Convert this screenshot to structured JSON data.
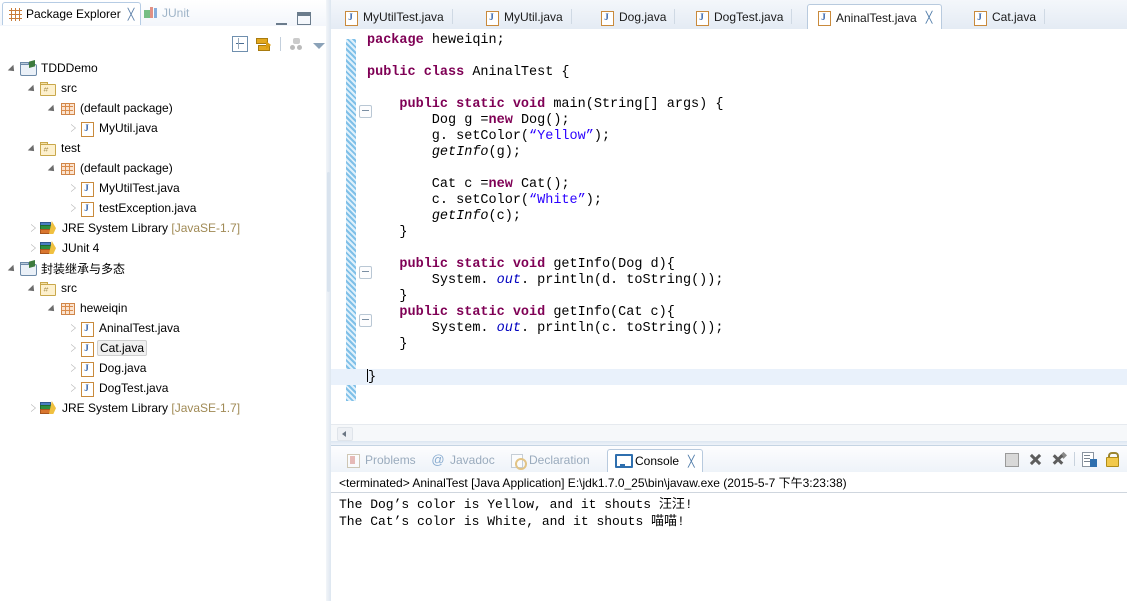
{
  "package_explorer": {
    "tabs": [
      {
        "label": "Package Explorer",
        "icon": "package-explorer-icon",
        "active": true,
        "close": "╳"
      },
      {
        "label": "JUnit",
        "icon": "junit-icon",
        "active": false,
        "close": "╳"
      }
    ],
    "toolbar": [
      {
        "name": "collapse-all-icon",
        "title": "Collapse All"
      },
      {
        "name": "link-with-editor-icon",
        "title": "Link with Editor"
      },
      {
        "name": "view-menu-icon",
        "title": "View Menu"
      },
      {
        "name": "view-chevron-down-icon",
        "title": "Menu"
      }
    ],
    "window_buttons": [
      {
        "name": "minimize-button",
        "glyph": "–"
      },
      {
        "name": "maximize-button",
        "glyph": "□"
      }
    ],
    "tree": [
      {
        "label": "TDDDemo",
        "icon": "java-project-icon",
        "indent": 0,
        "state": "expanded",
        "selected": false
      },
      {
        "label": "src",
        "icon": "source-folder-icon",
        "indent": 1,
        "state": "expanded",
        "selected": false
      },
      {
        "label": "(default package)",
        "icon": "package-icon",
        "indent": 2,
        "state": "expanded",
        "selected": false
      },
      {
        "label": "MyUtil.java",
        "icon": "java-file-icon",
        "indent": 3,
        "state": "collapsed",
        "selected": false
      },
      {
        "label": "test",
        "icon": "source-folder-icon",
        "indent": 1,
        "state": "expanded",
        "selected": false
      },
      {
        "label": "(default package)",
        "icon": "package-icon",
        "indent": 2,
        "state": "expanded",
        "selected": false
      },
      {
        "label": "MyUtilTest.java",
        "icon": "java-file-icon",
        "indent": 3,
        "state": "collapsed",
        "selected": false
      },
      {
        "label": "testException.java",
        "icon": "java-file-icon",
        "indent": 3,
        "state": "collapsed",
        "selected": false
      },
      {
        "label": "JRE System Library",
        "suffix": "[JavaSE-1.7]",
        "icon": "jre-library-icon",
        "indent": 1,
        "state": "collapsed",
        "selected": false
      },
      {
        "label": "JUnit 4",
        "icon": "jre-library-icon",
        "indent": 1,
        "state": "collapsed",
        "selected": false
      },
      {
        "label": "封装继承与多态",
        "icon": "java-project-icon",
        "indent": 0,
        "state": "expanded",
        "selected": false
      },
      {
        "label": "src",
        "icon": "source-folder-icon",
        "indent": 1,
        "state": "expanded",
        "selected": false
      },
      {
        "label": "heweiqin",
        "icon": "package-icon",
        "indent": 2,
        "state": "expanded",
        "selected": false
      },
      {
        "label": "AninalTest.java",
        "icon": "java-file-icon",
        "indent": 3,
        "state": "collapsed",
        "selected": false
      },
      {
        "label": "Cat.java",
        "icon": "java-file-icon",
        "indent": 3,
        "state": "collapsed",
        "selected": true
      },
      {
        "label": "Dog.java",
        "icon": "java-file-icon",
        "indent": 3,
        "state": "collapsed",
        "selected": false
      },
      {
        "label": "DogTest.java",
        "icon": "java-file-icon",
        "indent": 3,
        "state": "collapsed",
        "selected": false
      },
      {
        "label": "JRE System Library",
        "suffix": "[JavaSE-1.7]",
        "icon": "jre-library-icon",
        "indent": 1,
        "state": "collapsed",
        "selected": false
      }
    ]
  },
  "editor": {
    "tabs": [
      {
        "label": "MyUtilTest.java",
        "icon": "java-file-icon",
        "active": false,
        "close": "╳"
      },
      {
        "label": "MyUtil.java",
        "icon": "java-file-icon",
        "active": false,
        "close": "╳"
      },
      {
        "label": "Dog.java",
        "icon": "java-file-icon",
        "active": false,
        "close": "╳"
      },
      {
        "label": "DogTest.java",
        "icon": "java-file-icon",
        "active": false,
        "close": "╳"
      },
      {
        "label": "AninalTest.java",
        "icon": "java-file-icon",
        "active": true,
        "close": "╳"
      },
      {
        "label": "Cat.java",
        "icon": "java-file-icon",
        "active": false,
        "close": "╳"
      }
    ],
    "code_lines": [
      [
        {
          "t": "kw",
          "s": "package"
        },
        {
          "t": "p",
          "s": " heweiqin;"
        }
      ],
      [],
      [
        {
          "t": "kw",
          "s": "public class"
        },
        {
          "t": "p",
          "s": " AninalTest {"
        }
      ],
      [],
      [
        {
          "t": "p",
          "s": "    "
        },
        {
          "t": "kw",
          "s": "public static void"
        },
        {
          "t": "p",
          "s": " main(String[] args) {"
        }
      ],
      [
        {
          "t": "p",
          "s": "        Dog g ="
        },
        {
          "t": "kw",
          "s": "new"
        },
        {
          "t": "p",
          "s": " Dog();"
        }
      ],
      [
        {
          "t": "p",
          "s": "        g. setColor("
        },
        {
          "t": "str",
          "s": "“Yellow”"
        },
        {
          "t": "p",
          "s": ");"
        }
      ],
      [
        {
          "t": "p",
          "s": "        "
        },
        {
          "t": "mth",
          "s": "getInfo"
        },
        {
          "t": "p",
          "s": "(g);"
        }
      ],
      [],
      [
        {
          "t": "p",
          "s": "        Cat c ="
        },
        {
          "t": "kw",
          "s": "new"
        },
        {
          "t": "p",
          "s": " Cat();"
        }
      ],
      [
        {
          "t": "p",
          "s": "        c. setColor("
        },
        {
          "t": "str",
          "s": "“White”"
        },
        {
          "t": "p",
          "s": ");"
        }
      ],
      [
        {
          "t": "p",
          "s": "        "
        },
        {
          "t": "mth",
          "s": "getInfo"
        },
        {
          "t": "p",
          "s": "(c);"
        }
      ],
      [
        {
          "t": "p",
          "s": "    }"
        }
      ],
      [],
      [
        {
          "t": "p",
          "s": "    "
        },
        {
          "t": "kw",
          "s": "public static void"
        },
        {
          "t": "p",
          "s": " getInfo(Dog d){"
        }
      ],
      [
        {
          "t": "p",
          "s": "        System. "
        },
        {
          "t": "fld",
          "s": "out"
        },
        {
          "t": "p",
          "s": ". println(d. toString());"
        }
      ],
      [
        {
          "t": "p",
          "s": "    }"
        }
      ],
      [
        {
          "t": "p",
          "s": "    "
        },
        {
          "t": "kw",
          "s": "public static void"
        },
        {
          "t": "p",
          "s": " getInfo(Cat c){"
        }
      ],
      [
        {
          "t": "p",
          "s": "        System. "
        },
        {
          "t": "fld",
          "s": "out"
        },
        {
          "t": "p",
          "s": ". println(c. toString());"
        }
      ],
      [
        {
          "t": "p",
          "s": "    }"
        }
      ],
      [],
      [
        {
          "t": "cur",
          "s": "}"
        }
      ]
    ],
    "fold_markers": [
      105,
      272,
      317
    ],
    "colors": {
      "keyword": "#7F0055",
      "string": "#2A00FF",
      "field": "#0000C0",
      "current_line": "#E9F1FB"
    }
  },
  "console": {
    "tabs": [
      {
        "label": "Problems",
        "icon": "problems-icon",
        "active": false
      },
      {
        "label": "Javadoc",
        "icon": "javadoc-icon",
        "active": false
      },
      {
        "label": "Declaration",
        "icon": "declaration-icon",
        "active": false
      },
      {
        "label": "Console",
        "icon": "console-icon",
        "active": true,
        "close": "╳"
      }
    ],
    "toolbar": [
      {
        "name": "terminate-icon",
        "title": "Terminate"
      },
      {
        "name": "remove-launch-icon",
        "title": "Remove Launch"
      },
      {
        "name": "remove-all-terminated-icon",
        "title": "Remove All Terminated Launches"
      },
      {
        "name": "pin-console-icon",
        "title": "Pin Console"
      },
      {
        "name": "scroll-lock-icon",
        "title": "Scroll Lock"
      }
    ],
    "header": "<terminated> AninalTest [Java Application] E:\\jdk1.7.0_25\\bin\\javaw.exe (2015-5-7 下午3:23:38)",
    "output_lines": [
      "The Dog’s color is Yellow, and it shouts 汪汪!",
      "The Cat’s color is White, and it shouts 喵喵!"
    ]
  }
}
